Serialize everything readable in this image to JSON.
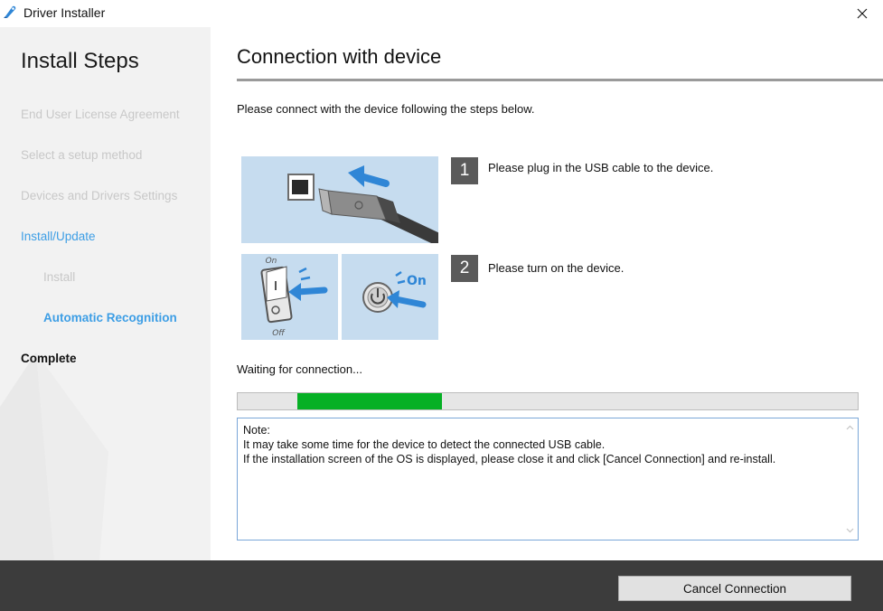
{
  "window": {
    "title": "Driver Installer"
  },
  "sidebar": {
    "heading": "Install Steps",
    "steps": [
      {
        "label": "End User License Agreement",
        "state": "done"
      },
      {
        "label": "Select a setup method",
        "state": "done"
      },
      {
        "label": "Devices and Drivers Settings",
        "state": "done"
      },
      {
        "label": "Install/Update",
        "state": "active"
      },
      {
        "label": "Install",
        "state": "done-sub"
      },
      {
        "label": "Automatic Recognition",
        "state": "current-sub"
      },
      {
        "label": "Complete",
        "state": "pending"
      }
    ]
  },
  "main": {
    "title": "Connection with device",
    "instructions": "Please connect with the device following the steps below.",
    "connection_steps": [
      {
        "number": "1",
        "text": "Please plug in the USB cable to the device."
      },
      {
        "number": "2",
        "text": "Please turn on the device."
      }
    ],
    "illustration_labels": {
      "switch_on": "On",
      "switch_off": "Off",
      "power_on": "On"
    },
    "status": "Waiting for connection...",
    "progress": {
      "start_fraction": 0.096,
      "end_fraction": 0.33,
      "color": "#06b025"
    },
    "note": "Note:\nIt may take some time for the device to detect the connected USB cable.\nIf the installation screen of the OS is displayed, please close it and click [Cancel Connection] and re-install."
  },
  "footer": {
    "cancel_label": "Cancel Connection"
  },
  "colors": {
    "accent": "#3d9ee5",
    "footer_bg": "#3c3c3c",
    "illustration_bg": "#c6dcef",
    "arrow": "#2f86d6"
  }
}
